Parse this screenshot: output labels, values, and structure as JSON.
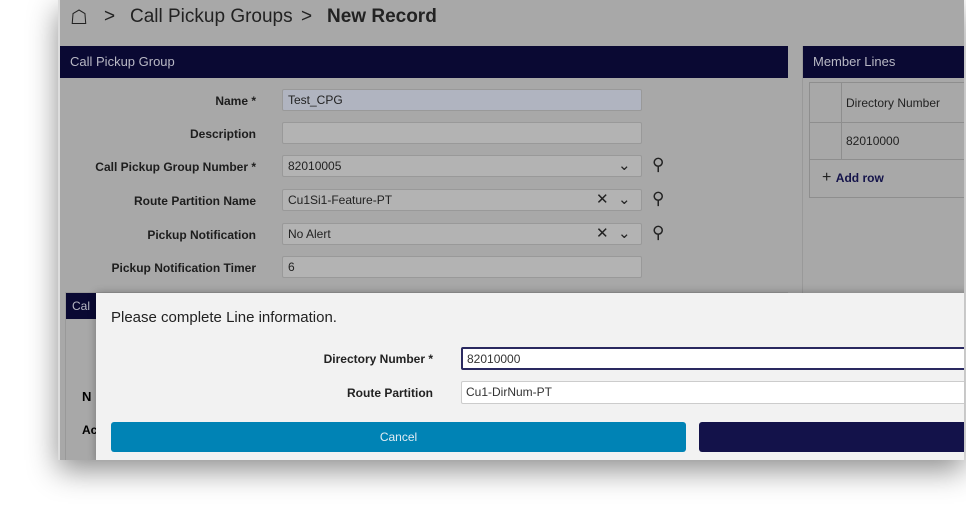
{
  "breadcrumb": {
    "home_icon": "home-icon",
    "items": [
      "Call Pickup Groups",
      "New Record"
    ]
  },
  "main_panel": {
    "title": "Call Pickup Group",
    "fields": [
      {
        "label": "Name *",
        "value": "Test_CPG"
      },
      {
        "label": "Description",
        "value": ""
      },
      {
        "label": "Call Pickup Group Number *",
        "value": "82010005"
      },
      {
        "label": "Route Partition Name",
        "value": "Cu1Si1-Feature-PT"
      },
      {
        "label": "Pickup Notification",
        "value": "No Alert"
      },
      {
        "label": "Pickup Notification Timer",
        "value": "6"
      }
    ]
  },
  "lower_panel": {
    "title": "Cal",
    "row1": "N",
    "row2": "Ac"
  },
  "member_lines": {
    "title": "Member Lines",
    "column": "Directory Number",
    "rows": [
      "82010000"
    ],
    "add_row": "Add row"
  },
  "modal": {
    "title": "Please complete Line information.",
    "directory_number_label": "Directory Number *",
    "directory_number_value": "82010000",
    "route_partition_label": "Route Partition",
    "route_partition_value": "Cu1-DirNum-PT",
    "cancel": "Cancel"
  },
  "colors": {
    "header": "#0a0933",
    "cancel": "#0083b5",
    "primary": "#13124a"
  }
}
